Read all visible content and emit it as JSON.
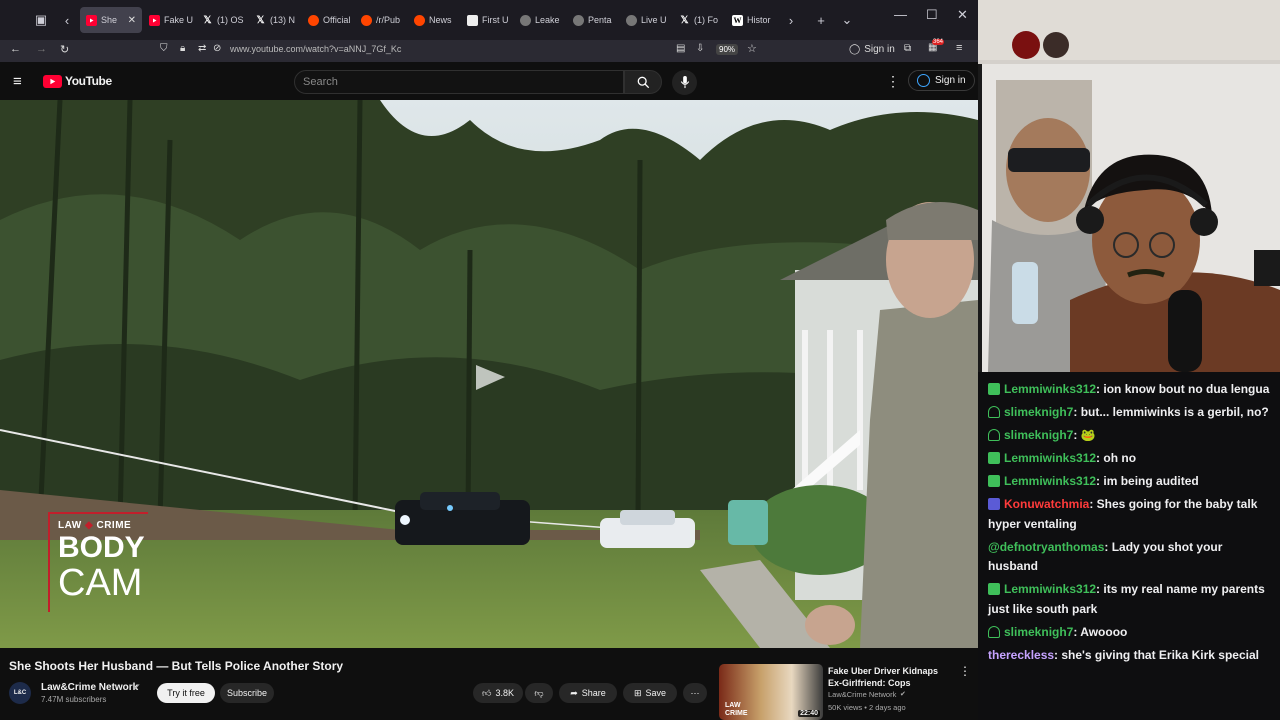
{
  "browser": {
    "tabs": [
      {
        "label": "She",
        "icon": "youtube-favicon",
        "active": true
      },
      {
        "label": "Fake U",
        "icon": "youtube-favicon"
      },
      {
        "label": "(1) OS",
        "icon": "x-favicon"
      },
      {
        "label": "(13) N",
        "icon": "x-favicon"
      },
      {
        "label": "Official",
        "icon": "reddit-favicon"
      },
      {
        "label": "/r/Pub",
        "icon": "reddit-favicon"
      },
      {
        "label": "News",
        "icon": "reddit-favicon"
      },
      {
        "label": "First U",
        "icon": "document-favicon"
      },
      {
        "label": "Leake",
        "icon": "site-favicon"
      },
      {
        "label": "Penta",
        "icon": "site-favicon"
      },
      {
        "label": "Live U",
        "icon": "site-favicon"
      },
      {
        "label": "(1) Fo",
        "icon": "x-favicon"
      },
      {
        "label": "Histor",
        "icon": "wikipedia-favicon"
      }
    ],
    "url": "www.youtube.com/watch?v=aNNJ_7Gf_Kc",
    "zoom": "90%",
    "sign_in": "Sign in",
    "ext_badge": "364"
  },
  "youtube": {
    "logo": "YouTube",
    "search_placeholder": "Search",
    "sign_in": "Sign in",
    "video_watermark": {
      "line1": "LAW",
      "line2": "CRIME",
      "line3": "BODY",
      "line4": "CAM"
    },
    "video_title": "She Shoots Her Husband — But Tells Police Another Story",
    "channel_name": "Law&Crime Network",
    "subscribers": "7.47M subscribers",
    "try_free": "Try it free",
    "subscribe": "Subscribe",
    "likes": "3.8K",
    "share": "Share",
    "save": "Save",
    "next_video": {
      "title": "Fake Uber Driver Kidnaps Ex-Girlfriend: Cops",
      "channel": "Law&Crime Network",
      "meta": "50K views • 2 days ago",
      "duration": "22:40",
      "thumb_text1": "LAW",
      "thumb_text2": "CRIME"
    }
  },
  "chat": {
    "messages": [
      {
        "user": "Lemmiwinks312",
        "text": ": ion know bout no dua lengua",
        "color": "#3fbf5a",
        "badge": "green"
      },
      {
        "user": "slimeknigh7",
        "text": ": but... lemmiwinks is a gerbil, no?",
        "color": "#3fbf5a",
        "badge": "outline"
      },
      {
        "user": "slimeknigh7",
        "text": ": 🐸",
        "color": "#3fbf5a",
        "badge": "outline"
      },
      {
        "user": "Lemmiwinks312",
        "text": ": oh no",
        "color": "#3fbf5a",
        "badge": "green"
      },
      {
        "user": "Lemmiwinks312",
        "text": ": im being audited",
        "color": "#3fbf5a",
        "badge": "green"
      },
      {
        "user": "Konuwatchmia",
        "text": ": Shes going for the baby talk hyper ventaling",
        "color": "#ff3b3b",
        "badge": "purple"
      },
      {
        "user": "@defnotryanthomas",
        "text": ": Lady you shot your husband",
        "color": "#3fbf5a",
        "badge": "none"
      },
      {
        "user": "Lemmiwinks312",
        "text": ": its my real name my parents just like south park",
        "color": "#3fbf5a",
        "badge": "green"
      },
      {
        "user": "slimeknigh7",
        "text": ": Awoooo",
        "color": "#3fbf5a",
        "badge": "outline"
      },
      {
        "user": "thereckless",
        "text": ": she's giving that Erika Kirk special",
        "color": "#c6a3ff",
        "badge": "none"
      }
    ]
  }
}
